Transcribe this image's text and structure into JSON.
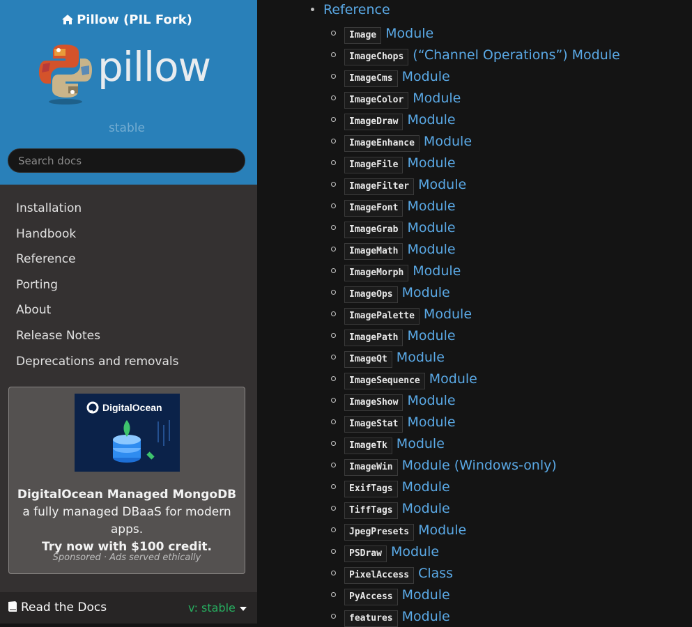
{
  "sidebar": {
    "home_label": "Pillow (PIL Fork)",
    "logo_text": "pillow",
    "version": "stable",
    "search_placeholder": "Search docs",
    "nav": [
      {
        "label": "Installation"
      },
      {
        "label": "Handbook"
      },
      {
        "label": "Reference"
      },
      {
        "label": "Porting"
      },
      {
        "label": "About"
      },
      {
        "label": "Release Notes"
      },
      {
        "label": "Deprecations and removals"
      }
    ],
    "ad": {
      "image_brand": "DigitalOcean",
      "title": "DigitalOcean Managed MongoDB",
      "body": " a fully managed DBaaS for modern apps.",
      "cta": "Try now with $100 credit.",
      "sponsor": "Sponsored · Ads served ethically"
    },
    "rtd": {
      "label": "Read the Docs",
      "version": "v: stable"
    }
  },
  "content": {
    "top_link": "Reference",
    "items": [
      {
        "code": "Image",
        "text": "Module"
      },
      {
        "code": "ImageChops",
        "text": "(“Channel Operations”) Module"
      },
      {
        "code": "ImageCms",
        "text": "Module"
      },
      {
        "code": "ImageColor",
        "text": "Module"
      },
      {
        "code": "ImageDraw",
        "text": "Module"
      },
      {
        "code": "ImageEnhance",
        "text": "Module"
      },
      {
        "code": "ImageFile",
        "text": "Module"
      },
      {
        "code": "ImageFilter",
        "text": "Module"
      },
      {
        "code": "ImageFont",
        "text": "Module"
      },
      {
        "code": "ImageGrab",
        "text": "Module"
      },
      {
        "code": "ImageMath",
        "text": "Module"
      },
      {
        "code": "ImageMorph",
        "text": "Module"
      },
      {
        "code": "ImageOps",
        "text": "Module"
      },
      {
        "code": "ImagePalette",
        "text": "Module"
      },
      {
        "code": "ImagePath",
        "text": "Module"
      },
      {
        "code": "ImageQt",
        "text": "Module"
      },
      {
        "code": "ImageSequence",
        "text": "Module"
      },
      {
        "code": "ImageShow",
        "text": "Module"
      },
      {
        "code": "ImageStat",
        "text": "Module"
      },
      {
        "code": "ImageTk",
        "text": "Module"
      },
      {
        "code": "ImageWin",
        "text": "Module (Windows-only)"
      },
      {
        "code": "ExifTags",
        "text": "Module"
      },
      {
        "code": "TiffTags",
        "text": "Module"
      },
      {
        "code": "JpegPresets",
        "text": "Module"
      },
      {
        "code": "PSDraw",
        "text": "Module"
      },
      {
        "code": "PixelAccess",
        "text": "Class"
      },
      {
        "code": "PyAccess",
        "text": "Module"
      },
      {
        "code": "features",
        "text": "Module"
      }
    ]
  },
  "colors": {
    "sidebar_top": "#2980b9",
    "sidebar_bg": "#343131",
    "content_bg": "#141414",
    "link": "#5aa9e6",
    "version_green": "#27ae60"
  },
  "icons": [
    "home-icon",
    "book-icon",
    "caret-down-icon",
    "python-logo-icon"
  ]
}
